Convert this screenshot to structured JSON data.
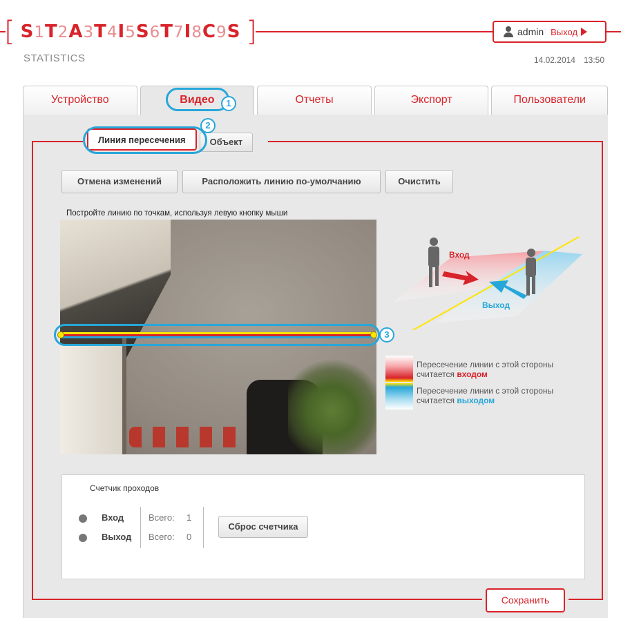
{
  "header": {
    "logo_letters": [
      "S",
      "1",
      "T",
      "2",
      "A",
      "3",
      "T",
      "4",
      "I",
      "5",
      "S",
      "6",
      "T",
      "7",
      "I",
      "8",
      "C",
      "9",
      "S"
    ],
    "subtitle": "STATISTICS",
    "date": "14.02.2014",
    "time": "13:50",
    "user": "admin",
    "logout": "Выход",
    "accent_color": "#d8232a"
  },
  "tabs": [
    {
      "label": "Устройство"
    },
    {
      "label": "Видео",
      "active": true
    },
    {
      "label": "Отчеты"
    },
    {
      "label": "Экспорт"
    },
    {
      "label": "Пользователи"
    }
  ],
  "subtabs": [
    {
      "label": "Линия пересечения",
      "active": true
    },
    {
      "label": "Объект"
    }
  ],
  "toolbar": {
    "undo_label": "Отмена изменений",
    "default_line_label": "Расположить линию по-умолчанию",
    "clear_label": "Очистить"
  },
  "hint": "Постройте линию по точкам, используя левую кнопку мыши",
  "callouts": [
    "1",
    "2",
    "3"
  ],
  "diagram": {
    "entry_label": "Вход",
    "exit_label": "Выход",
    "entry_color": "#d8232a",
    "exit_color": "#27a7d9"
  },
  "legend": {
    "in_text": "Пересечение линии с этой стороны считается",
    "in_word": "входом",
    "out_text": "Пересечение линии с этой стороны считается",
    "out_word": "выходом"
  },
  "counter": {
    "title": "Счетчик проходов",
    "rows": [
      {
        "label": "Вход",
        "total_label": "Всего:",
        "total": "1"
      },
      {
        "label": "Выход",
        "total_label": "Всего:",
        "total": "0"
      }
    ],
    "reset_label": "Сброс счетчика"
  },
  "save_label": "Сохранить"
}
